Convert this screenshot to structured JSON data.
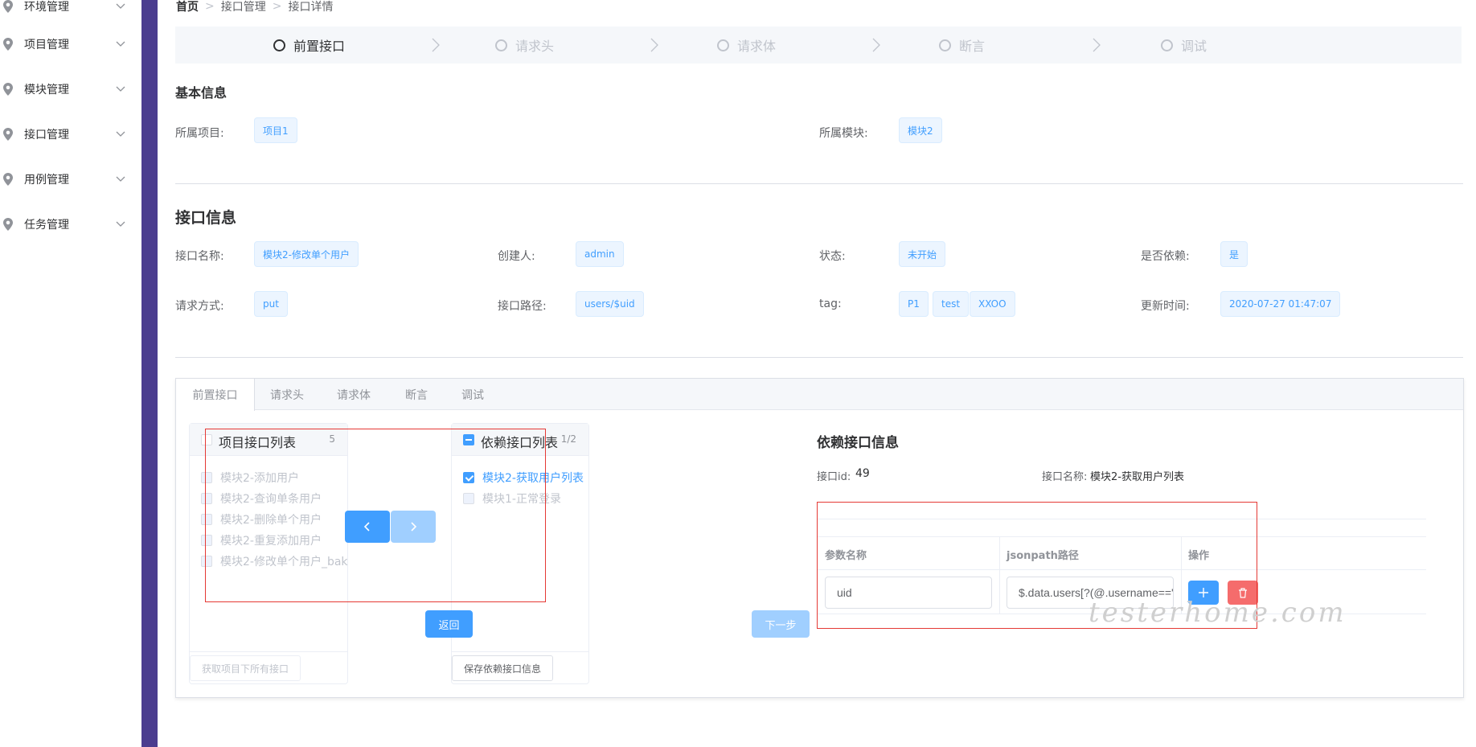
{
  "sidebar": {
    "items": [
      {
        "label": "环境管理",
        "icon": "location-pin-icon"
      },
      {
        "label": "项目管理",
        "icon": "location-pin-icon"
      },
      {
        "label": "模块管理",
        "icon": "location-pin-icon"
      },
      {
        "label": "接口管理",
        "icon": "location-pin-icon"
      },
      {
        "label": "用例管理",
        "icon": "location-pin-icon"
      },
      {
        "label": "任务管理",
        "icon": "location-pin-icon"
      }
    ]
  },
  "breadcrumb": [
    "首页",
    "接口管理",
    "接口详情"
  ],
  "steps": [
    "前置接口",
    "请求头",
    "请求体",
    "断言",
    "调试"
  ],
  "basic_info": {
    "title": "基本信息",
    "project_label": "所属项目:",
    "project_value": "项目1",
    "module_label": "所属模块:",
    "module_value": "模块2"
  },
  "api_info": {
    "title": "接口信息",
    "name_label": "接口名称:",
    "name_value": "模块2-修改单个用户",
    "creator_label": "创建人:",
    "creator_value": "admin",
    "status_label": "状态:",
    "status_value": "未开始",
    "depend_label": "是否依赖:",
    "depend_value": "是",
    "method_label": "请求方式:",
    "method_value": "put",
    "path_label": "接口路径:",
    "path_value": "users/$uid",
    "tag_label": "tag:",
    "tags": [
      "P1",
      "test",
      "XXOO"
    ],
    "updated_label": "更新时间:",
    "updated_value": "2020-07-27 01:47:07"
  },
  "tabs": [
    "前置接口",
    "请求头",
    "请求体",
    "断言",
    "调试"
  ],
  "transfer": {
    "left": {
      "title": "项目接口列表",
      "count": "5",
      "items": [
        "模块2-添加用户",
        "模块2-查询单条用户",
        "模块2-删除单个用户",
        "模块2-重复添加用户",
        "模块2-修改单个用户_bak"
      ],
      "footer_button": "获取项目下所有接口"
    },
    "right": {
      "title": "依赖接口列表",
      "count": "1/2",
      "items": [
        {
          "label": "模块2-获取用户列表",
          "checked": true
        },
        {
          "label": "模块1-正常登录",
          "checked": false
        }
      ],
      "footer_button": "保存依赖接口信息"
    }
  },
  "depend_info": {
    "title": "依赖接口信息",
    "id_label": "接口id:",
    "id_value": "49",
    "name_label": "接口名称:",
    "name_value": "模块2-获取用户列表",
    "columns": [
      "参数名称",
      "jsonpath路径",
      "操作"
    ],
    "rows": [
      {
        "param": "uid",
        "jsonpath": "$.data.users[?(@.username==\"luh"
      }
    ]
  },
  "buttons": {
    "back": "返回",
    "next": "下一步"
  },
  "colors": {
    "primary": "#409eff",
    "primary_light": "#a0cfff",
    "danger": "#f56c6c",
    "sidebar_divider": "#4b3d8f"
  },
  "watermark": "testerhome.com"
}
